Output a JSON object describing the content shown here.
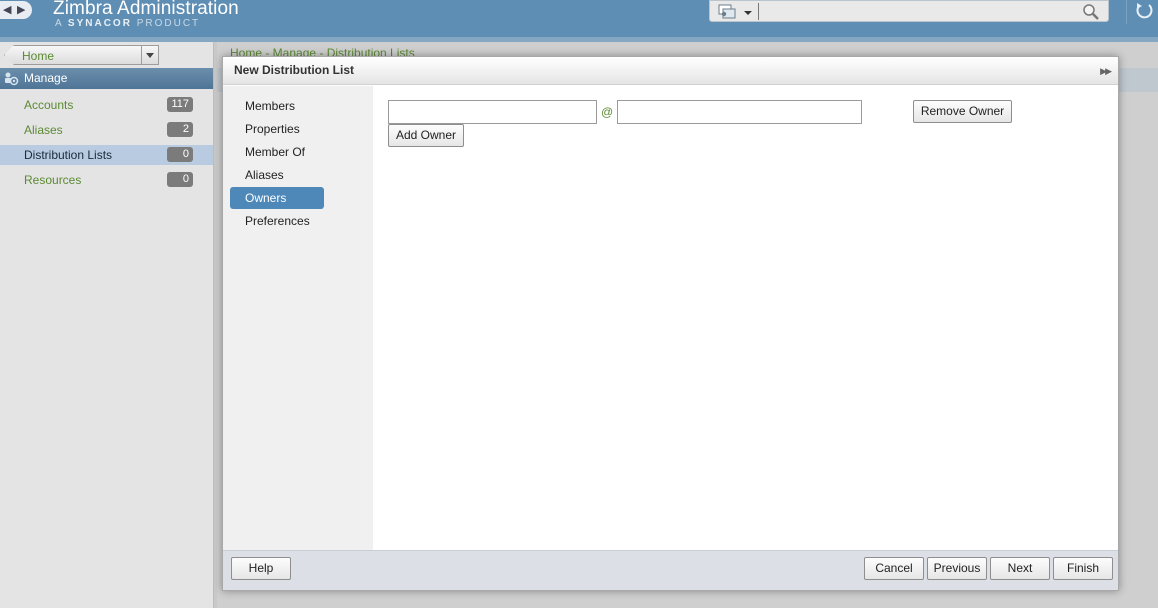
{
  "header": {
    "title": "Zimbra Administration",
    "subtitle_prefix": "A",
    "subtitle_brand": "SYNACOR",
    "subtitle_suffix": "PRODUCT",
    "search_value": ""
  },
  "sidebar": {
    "home_label": "Home",
    "manage_label": "Manage",
    "items": [
      {
        "label": "Accounts",
        "count": "117"
      },
      {
        "label": "Aliases",
        "count": "2"
      },
      {
        "label": "Distribution Lists",
        "count": "0"
      },
      {
        "label": "Resources",
        "count": "0"
      }
    ],
    "selected_index": 2
  },
  "content": {
    "breadcrumb": "Home - Manage - Distribution Lists"
  },
  "dialog": {
    "title": "New Distribution List",
    "nav": [
      "Members",
      "Properties",
      "Member Of",
      "Aliases",
      "Owners",
      "Preferences"
    ],
    "selected_nav": "Owners",
    "owner_local_value": "",
    "at_sign": "@",
    "owner_domain_value": "",
    "remove_owner_label": "Remove Owner",
    "add_owner_label": "Add Owner",
    "footer": {
      "help": "Help",
      "cancel": "Cancel",
      "previous": "Previous",
      "next": "Next",
      "finish": "Finish"
    }
  },
  "colors": {
    "header_bg": "#5f8eb4",
    "link_green": "#5b8a32",
    "selected_nav": "#4d88b9",
    "sidebar_selected": "#b9cbe0"
  }
}
